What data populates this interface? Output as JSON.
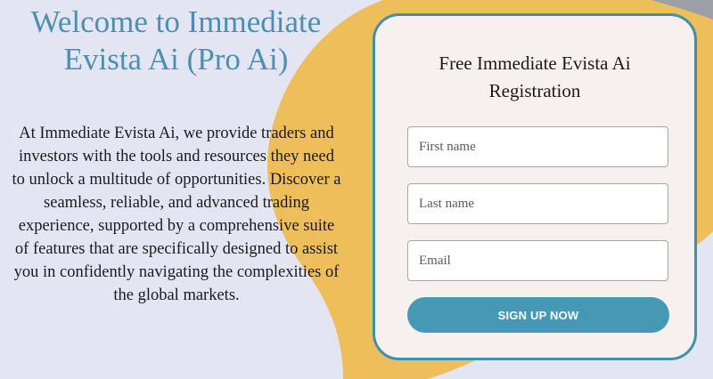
{
  "hero": {
    "title_line1": "Welcome to Immediate",
    "title_line2": "Evista Ai (Pro Ai)",
    "description": "At Immediate Evista Ai, we provide traders and investors with the tools and resources they need to unlock a multitude of opportunities. Discover a seamless, reliable, and advanced trading experience, supported by a comprehensive suite of features that are specifically designed to assist you in confidently navigating the complexities of the global markets."
  },
  "form": {
    "title_line1": "Free Immediate Evista Ai",
    "title_line2": "Registration",
    "first_name_placeholder": "First name",
    "last_name_placeholder": "Last name",
    "email_placeholder": "Email",
    "signup_label": "SIGN UP NOW"
  },
  "colors": {
    "background": "#e3e5f2",
    "accent_blob": "#edbe5a",
    "title": "#4a90b3",
    "card_border": "#3f8fae",
    "button": "#4699b4"
  }
}
